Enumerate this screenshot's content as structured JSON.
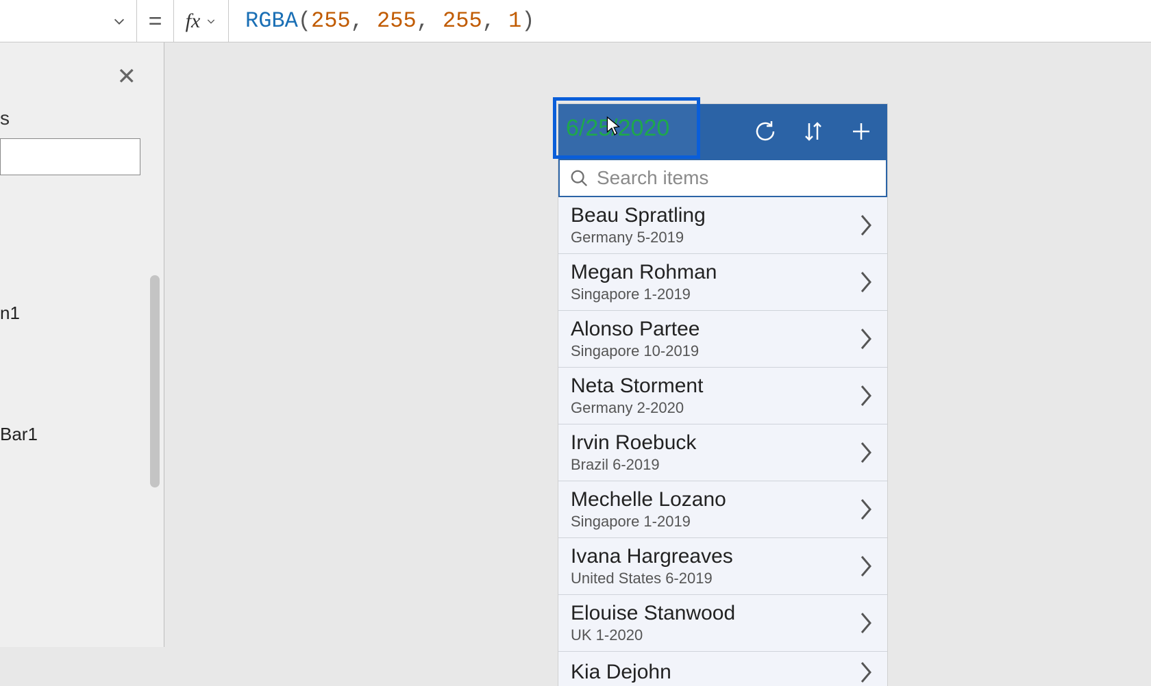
{
  "formula": {
    "fn": "RGBA",
    "args": [
      "255",
      "255",
      "255",
      "1"
    ]
  },
  "panel": {
    "title_fragment": "ts",
    "item_a": "n1",
    "item_b": "Bar1"
  },
  "app": {
    "header_title": "6/25/2020",
    "search_placeholder": "Search items",
    "items": [
      {
        "name": "Beau Spratling",
        "sub": "Germany 5-2019"
      },
      {
        "name": "Megan Rohman",
        "sub": "Singapore 1-2019"
      },
      {
        "name": "Alonso Partee",
        "sub": "Singapore 10-2019"
      },
      {
        "name": "Neta Storment",
        "sub": "Germany 2-2020"
      },
      {
        "name": "Irvin Roebuck",
        "sub": "Brazil 6-2019"
      },
      {
        "name": "Mechelle Lozano",
        "sub": "Singapore 1-2019"
      },
      {
        "name": "Ivana Hargreaves",
        "sub": "United States 6-2019"
      },
      {
        "name": "Elouise Stanwood",
        "sub": "UK 1-2020"
      },
      {
        "name": "Kia Dejohn",
        "sub": ""
      }
    ]
  }
}
